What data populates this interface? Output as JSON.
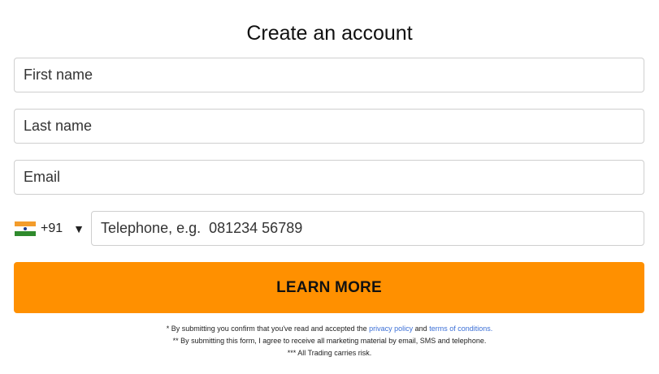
{
  "form": {
    "title": "Create an account",
    "first_name_placeholder": "First name",
    "last_name_placeholder": "Last name",
    "email_placeholder": "Email",
    "phone": {
      "country_flag_icon": "india-flag-icon",
      "dial_code": "+91",
      "dropdown_caret": "▼",
      "placeholder": "Telephone, e.g.  081234 56789"
    },
    "submit_label": "LEARN MORE",
    "accent_color": "#ff9000"
  },
  "disclaimer": {
    "line1_prefix": "* By submitting you confirm that you've read and accepted the ",
    "privacy_link": "privacy policy",
    "line1_and": " and ",
    "terms_link": "terms of conditions.",
    "line2": "** By submitting this form, I agree to receive all marketing material by email, SMS and telephone.",
    "line3": "*** All Trading carries risk.",
    "link_color": "#3b6fd6"
  }
}
